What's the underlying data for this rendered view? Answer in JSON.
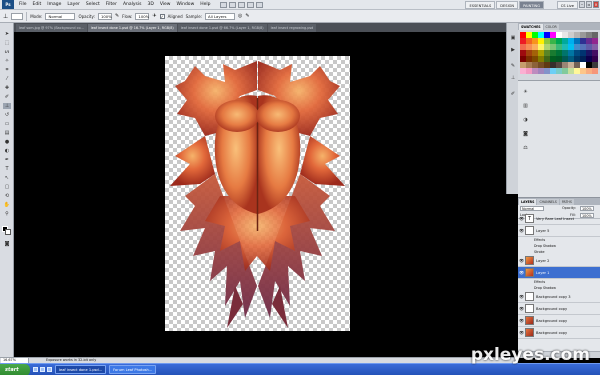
{
  "menubar": {
    "app_logo": "Ps",
    "items": [
      "File",
      "Edit",
      "Image",
      "Layer",
      "Select",
      "Filter",
      "Analysis",
      "3D",
      "View",
      "Window",
      "Help"
    ],
    "workspaces": [
      "ESSENTIALS",
      "DESIGN",
      "PAINTING"
    ],
    "active_workspace": "PAINTING",
    "cs_live": "CS Live"
  },
  "options": {
    "mode_label": "Mode:",
    "mode_value": "Normal",
    "opacity_label": "Opacity:",
    "opacity_value": "100%",
    "flow_label": "Flow:",
    "flow_value": "100%",
    "aligned_label": "Aligned",
    "sample_label": "Sample:",
    "sample_value": "All Layers"
  },
  "tabs": [
    "leaf som.jpg @ 97% (Background co...",
    "leaf insect done 1.psd @ 16.7% (Layer 1, RGB/8)",
    "leaf insect done 1.psd @ 66.7% (Layer 1, RGB/8)",
    "leaf insect regrowing.psd"
  ],
  "active_tab_index": 1,
  "statusbar": {
    "zoom": "16.67%",
    "info": "Exposure works in 32-bit only"
  },
  "panels": {
    "swatch_tabs": [
      "SWATCHES",
      "COLOR"
    ],
    "swatch_colors": [
      "#ff0000",
      "#ffff00",
      "#00ff00",
      "#00ffff",
      "#0000ff",
      "#ff00ff",
      "#ffffff",
      "#e6e6e6",
      "#cccccc",
      "#b3b3b3",
      "#999999",
      "#808080",
      "#666666",
      "#ed1c24",
      "#f26522",
      "#f7941d",
      "#fff200",
      "#8dc63f",
      "#39b54a",
      "#00a651",
      "#00a99d",
      "#00aeef",
      "#0072bc",
      "#2e3192",
      "#662d91",
      "#92278f",
      "#f26c4f",
      "#f68e56",
      "#fbaf5d",
      "#fff568",
      "#acd373",
      "#7cc576",
      "#3cb878",
      "#1cbbb4",
      "#00bff3",
      "#448ccb",
      "#5674b9",
      "#605ca8",
      "#855fa8",
      "#9e0b0f",
      "#a0410d",
      "#a36209",
      "#aba000",
      "#598527",
      "#197b30",
      "#007236",
      "#00746b",
      "#0076a3",
      "#004a80",
      "#003471",
      "#1b1464",
      "#440e62",
      "#790000",
      "#7b2e00",
      "#7d4900",
      "#827b00",
      "#406618",
      "#005e20",
      "#005826",
      "#005952",
      "#005b7f",
      "#003663",
      "#002157",
      "#0d004c",
      "#32004b",
      "#c69c6d",
      "#a67c52",
      "#8c6239",
      "#754c24",
      "#603913",
      "#362f2d",
      "#534741",
      "#998675",
      "#c7b299",
      "#736357",
      "#ffffff",
      "#000000",
      "#3a3a3a",
      "#fbafd2",
      "#f49ac2",
      "#bd8cbf",
      "#a186be",
      "#8393ca",
      "#6dcff6",
      "#7accc8",
      "#82ca9c",
      "#c4df9b",
      "#fff799",
      "#fdc689",
      "#f9ad81",
      "#f69679"
    ],
    "layers_tabs": [
      "LAYERS",
      "CHANNELS",
      "PATHS"
    ],
    "blend_mode": "Normal",
    "opacity_label": "Opacity:",
    "opacity_value": "100%",
    "lock_label": "Lock:",
    "fill_label": "Fill:",
    "fill_value": "100%",
    "layers": [
      {
        "name": "Very Rare Leaf Insect",
        "kind": "text"
      },
      {
        "name": "Layer 5",
        "kind": "blank"
      },
      {
        "name": "Effects",
        "kind": "fx"
      },
      {
        "name": "Drop Shadow",
        "kind": "fx"
      },
      {
        "name": "Stroke",
        "kind": "fx"
      },
      {
        "name": "Layer 2",
        "kind": "art"
      },
      {
        "name": "Layer 1",
        "kind": "art",
        "selected": true
      },
      {
        "name": "Effects",
        "kind": "fx"
      },
      {
        "name": "Drop Shadow",
        "kind": "fx"
      },
      {
        "name": "Background copy 3",
        "kind": "blank"
      },
      {
        "name": "Background copy",
        "kind": "blank"
      },
      {
        "name": "Background copy",
        "kind": "art2"
      },
      {
        "name": "Background copy",
        "kind": "art2"
      }
    ]
  },
  "taskbar": {
    "start": "start",
    "buttons": [
      "leaf insect done 1.psd...",
      "Forum Leaf Photosh..."
    ],
    "active_button_index": 0
  },
  "watermark": "pxleyes.com"
}
